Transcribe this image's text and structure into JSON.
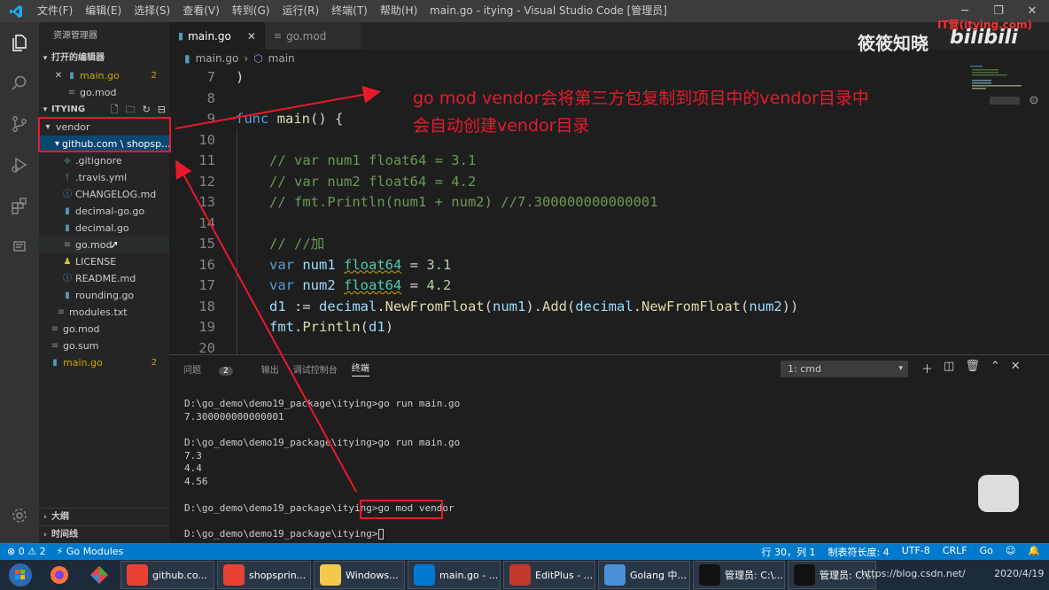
{
  "titlebar": {
    "menu": [
      "文件(F)",
      "编辑(E)",
      "选择(S)",
      "查看(V)",
      "转到(G)",
      "运行(R)",
      "终端(T)",
      "帮助(H)"
    ],
    "title": "main.go - itying - Visual Studio Code [管理员]",
    "controls": [
      "─",
      "❐",
      "✕"
    ]
  },
  "sidebar": {
    "title": "资源管理器",
    "open_editors": {
      "label": "打开的编辑器",
      "items": [
        {
          "name": "main.go",
          "badge": "2"
        },
        {
          "name": "go.mod"
        }
      ]
    },
    "workspace": {
      "label": "ITYING",
      "tree": [
        {
          "name": "vendor",
          "depth": 0,
          "kind": "folder-open"
        },
        {
          "name": "github.com \\ shopsp...",
          "depth": 1,
          "kind": "folder-open"
        },
        {
          "name": ".gitignore",
          "depth": 2,
          "kind": "git"
        },
        {
          "name": ".travis.yml",
          "depth": 2,
          "kind": "yml"
        },
        {
          "name": "CHANGELOG.md",
          "depth": 2,
          "kind": "md"
        },
        {
          "name": "decimal-go.go",
          "depth": 2,
          "kind": "go"
        },
        {
          "name": "decimal.go",
          "depth": 2,
          "kind": "go"
        },
        {
          "name": "go.mod",
          "depth": 2,
          "kind": "mod"
        },
        {
          "name": "LICENSE",
          "depth": 2,
          "kind": "license"
        },
        {
          "name": "README.md",
          "depth": 2,
          "kind": "md"
        },
        {
          "name": "rounding.go",
          "depth": 2,
          "kind": "go"
        },
        {
          "name": "modules.txt",
          "depth": 1,
          "kind": "txt"
        },
        {
          "name": "go.mod",
          "depth": 0,
          "kind": "mod"
        },
        {
          "name": "go.sum",
          "depth": 0,
          "kind": "sum"
        },
        {
          "name": "main.go",
          "depth": 0,
          "kind": "go",
          "badge": "2"
        }
      ]
    },
    "outline_label": "大纲",
    "timeline_label": "时间线"
  },
  "tabs": [
    {
      "label": "main.go",
      "active": true,
      "close": "✕"
    },
    {
      "label": "go.mod",
      "active": false
    }
  ],
  "breadcrumbs": [
    "main.go",
    "›",
    "main"
  ],
  "code": [
    {
      "n": "7",
      "text": ")"
    },
    {
      "n": "8",
      "text": ""
    },
    {
      "n": "9",
      "text": "func main() {"
    },
    {
      "n": "10",
      "text": ""
    },
    {
      "n": "11",
      "text": "// var num1 float64 = 3.1"
    },
    {
      "n": "12",
      "text": "// var num2 float64 = 4.2"
    },
    {
      "n": "13",
      "text": "// fmt.Println(num1 + num2) //7.300000000000001"
    },
    {
      "n": "14",
      "text": ""
    },
    {
      "n": "15",
      "text": "// //加"
    },
    {
      "n": "16",
      "text": "var num1 float64 = 3.1"
    },
    {
      "n": "17",
      "text": "var num2 float64 = 4.2"
    },
    {
      "n": "18",
      "text": "d1 := decimal.NewFromFloat(num1).Add(decimal.NewFromFloat(num2))"
    },
    {
      "n": "19",
      "text": "fmt.Println(d1)"
    },
    {
      "n": "20",
      "text": ""
    }
  ],
  "panel": {
    "tabs": [
      "问题",
      "输出",
      "调试控制台",
      "终端"
    ],
    "problems_badge": "2",
    "terminal_select": "1: cmd",
    "terminal_lines": [
      "D:\\go_demo\\demo19_package\\itying>go run main.go",
      "7.300000000000001",
      "",
      "D:\\go_demo\\demo19_package\\itying>go run main.go",
      "7.3",
      "4.4",
      "4.56",
      "",
      "D:\\go_demo\\demo19_package\\itying>go mod vendor",
      "",
      "D:\\go_demo\\demo19_package\\itying>"
    ]
  },
  "statusbar": {
    "errors": "⊗ 0",
    "warnings": "⚠ 2",
    "go_modules": "Go Modules",
    "position": "行 30，列 1",
    "indent": "制表符长度: 4",
    "encoding": "UTF-8",
    "eol": "CRLF",
    "language": "Go"
  },
  "taskbar": {
    "items": [
      {
        "label": "github.co...",
        "color": "#e94235"
      },
      {
        "label": "shopsprin...",
        "color": "#e94235"
      },
      {
        "label": "Windows...",
        "color": "#f2c94c"
      },
      {
        "label": "main.go - ...",
        "color": "#0078d4"
      },
      {
        "label": "EditPlus - ...",
        "color": "#c0392b"
      },
      {
        "label": "Golang 中...",
        "color": "#4a90d9"
      },
      {
        "label": "管理员: C:\\...",
        "color": "#111111"
      },
      {
        "label": "管理员: C:\\...",
        "color": "#111111"
      }
    ],
    "clock": "2020/4/19"
  },
  "annotation": {
    "line1": "go mod vendor会将第三方包复制到项目中的vendor目录中",
    "line2": "会自动创建vendor目录"
  },
  "watermark": {
    "channel": "筱筱知晓",
    "site": "IT营(itying.com)",
    "bilibili": "bilibili",
    "csdn": "https://blog.csdn.net/"
  },
  "colors": {
    "accent": "#007acc",
    "annotation": "#e8192c",
    "warning": "#cca700"
  }
}
